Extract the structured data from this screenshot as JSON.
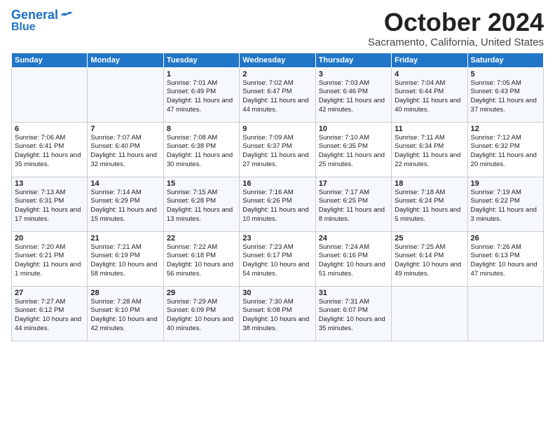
{
  "header": {
    "logo_line1": "General",
    "logo_line2": "Blue",
    "month": "October 2024",
    "location": "Sacramento, California, United States"
  },
  "days_of_week": [
    "Sunday",
    "Monday",
    "Tuesday",
    "Wednesday",
    "Thursday",
    "Friday",
    "Saturday"
  ],
  "weeks": [
    [
      {
        "day": "",
        "info": ""
      },
      {
        "day": "",
        "info": ""
      },
      {
        "day": "1",
        "info": "Sunrise: 7:01 AM\nSunset: 6:49 PM\nDaylight: 11 hours and 47 minutes."
      },
      {
        "day": "2",
        "info": "Sunrise: 7:02 AM\nSunset: 6:47 PM\nDaylight: 11 hours and 44 minutes."
      },
      {
        "day": "3",
        "info": "Sunrise: 7:03 AM\nSunset: 6:46 PM\nDaylight: 11 hours and 42 minutes."
      },
      {
        "day": "4",
        "info": "Sunrise: 7:04 AM\nSunset: 6:44 PM\nDaylight: 11 hours and 40 minutes."
      },
      {
        "day": "5",
        "info": "Sunrise: 7:05 AM\nSunset: 6:43 PM\nDaylight: 11 hours and 37 minutes."
      }
    ],
    [
      {
        "day": "6",
        "info": "Sunrise: 7:06 AM\nSunset: 6:41 PM\nDaylight: 11 hours and 35 minutes."
      },
      {
        "day": "7",
        "info": "Sunrise: 7:07 AM\nSunset: 6:40 PM\nDaylight: 11 hours and 32 minutes."
      },
      {
        "day": "8",
        "info": "Sunrise: 7:08 AM\nSunset: 6:38 PM\nDaylight: 11 hours and 30 minutes."
      },
      {
        "day": "9",
        "info": "Sunrise: 7:09 AM\nSunset: 6:37 PM\nDaylight: 11 hours and 27 minutes."
      },
      {
        "day": "10",
        "info": "Sunrise: 7:10 AM\nSunset: 6:35 PM\nDaylight: 11 hours and 25 minutes."
      },
      {
        "day": "11",
        "info": "Sunrise: 7:11 AM\nSunset: 6:34 PM\nDaylight: 11 hours and 22 minutes."
      },
      {
        "day": "12",
        "info": "Sunrise: 7:12 AM\nSunset: 6:32 PM\nDaylight: 11 hours and 20 minutes."
      }
    ],
    [
      {
        "day": "13",
        "info": "Sunrise: 7:13 AM\nSunset: 6:31 PM\nDaylight: 11 hours and 17 minutes."
      },
      {
        "day": "14",
        "info": "Sunrise: 7:14 AM\nSunset: 6:29 PM\nDaylight: 11 hours and 15 minutes."
      },
      {
        "day": "15",
        "info": "Sunrise: 7:15 AM\nSunset: 6:28 PM\nDaylight: 11 hours and 13 minutes."
      },
      {
        "day": "16",
        "info": "Sunrise: 7:16 AM\nSunset: 6:26 PM\nDaylight: 11 hours and 10 minutes."
      },
      {
        "day": "17",
        "info": "Sunrise: 7:17 AM\nSunset: 6:25 PM\nDaylight: 11 hours and 8 minutes."
      },
      {
        "day": "18",
        "info": "Sunrise: 7:18 AM\nSunset: 6:24 PM\nDaylight: 11 hours and 5 minutes."
      },
      {
        "day": "19",
        "info": "Sunrise: 7:19 AM\nSunset: 6:22 PM\nDaylight: 11 hours and 3 minutes."
      }
    ],
    [
      {
        "day": "20",
        "info": "Sunrise: 7:20 AM\nSunset: 6:21 PM\nDaylight: 11 hours and 1 minute."
      },
      {
        "day": "21",
        "info": "Sunrise: 7:21 AM\nSunset: 6:19 PM\nDaylight: 10 hours and 58 minutes."
      },
      {
        "day": "22",
        "info": "Sunrise: 7:22 AM\nSunset: 6:18 PM\nDaylight: 10 hours and 56 minutes."
      },
      {
        "day": "23",
        "info": "Sunrise: 7:23 AM\nSunset: 6:17 PM\nDaylight: 10 hours and 54 minutes."
      },
      {
        "day": "24",
        "info": "Sunrise: 7:24 AM\nSunset: 6:16 PM\nDaylight: 10 hours and 51 minutes."
      },
      {
        "day": "25",
        "info": "Sunrise: 7:25 AM\nSunset: 6:14 PM\nDaylight: 10 hours and 49 minutes."
      },
      {
        "day": "26",
        "info": "Sunrise: 7:26 AM\nSunset: 6:13 PM\nDaylight: 10 hours and 47 minutes."
      }
    ],
    [
      {
        "day": "27",
        "info": "Sunrise: 7:27 AM\nSunset: 6:12 PM\nDaylight: 10 hours and 44 minutes."
      },
      {
        "day": "28",
        "info": "Sunrise: 7:28 AM\nSunset: 6:10 PM\nDaylight: 10 hours and 42 minutes."
      },
      {
        "day": "29",
        "info": "Sunrise: 7:29 AM\nSunset: 6:09 PM\nDaylight: 10 hours and 40 minutes."
      },
      {
        "day": "30",
        "info": "Sunrise: 7:30 AM\nSunset: 6:08 PM\nDaylight: 10 hours and 38 minutes."
      },
      {
        "day": "31",
        "info": "Sunrise: 7:31 AM\nSunset: 6:07 PM\nDaylight: 10 hours and 35 minutes."
      },
      {
        "day": "",
        "info": ""
      },
      {
        "day": "",
        "info": ""
      }
    ]
  ]
}
